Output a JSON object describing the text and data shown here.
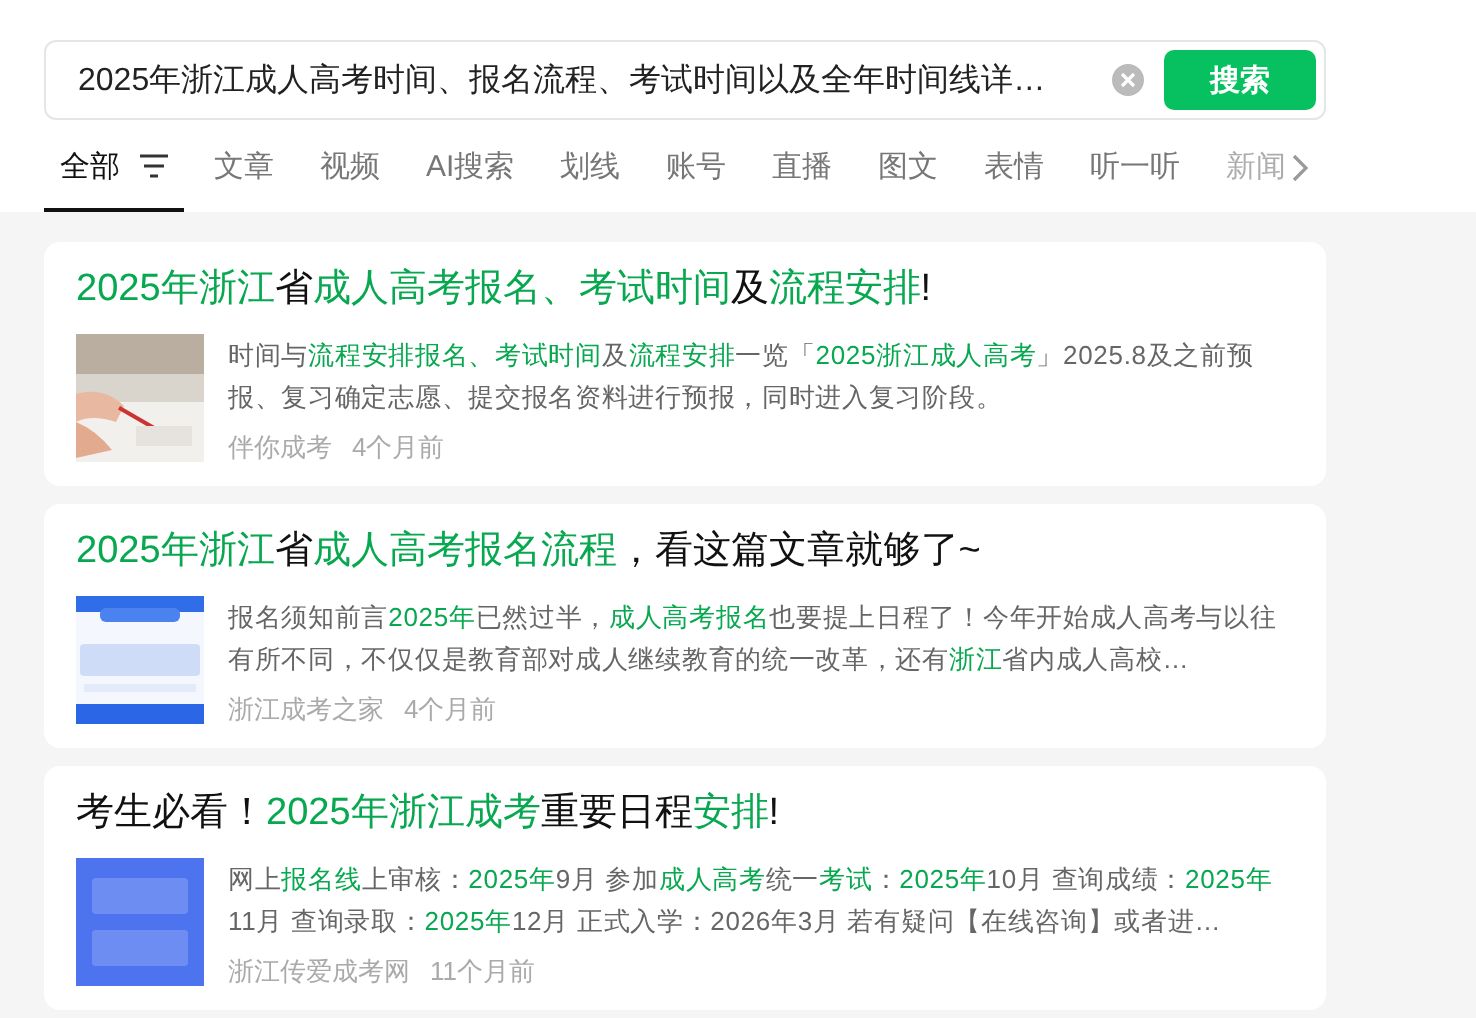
{
  "search": {
    "value": "2025年浙江成人高考时间、报名流程、考试时间以及全年时间线详…",
    "button": "搜索"
  },
  "tabs": [
    {
      "label": "全部",
      "selected": true,
      "filter": true
    },
    {
      "label": "文章",
      "selected": false
    },
    {
      "label": "视频",
      "selected": false
    },
    {
      "label": "AI搜索",
      "selected": false
    },
    {
      "label": "划线",
      "selected": false
    },
    {
      "label": "账号",
      "selected": false
    },
    {
      "label": "直播",
      "selected": false
    },
    {
      "label": "图文",
      "selected": false
    },
    {
      "label": "表情",
      "selected": false
    },
    {
      "label": "听一听",
      "selected": false
    },
    {
      "label": "新闻",
      "selected": false
    }
  ],
  "results": [
    {
      "title": [
        {
          "text": "2025年浙江",
          "highlight": true
        },
        {
          "text": "省",
          "highlight": false
        },
        {
          "text": "成人高考报名、考试时间",
          "highlight": true
        },
        {
          "text": "及",
          "highlight": false
        },
        {
          "text": "流程安排",
          "highlight": true
        },
        {
          "text": "!",
          "highlight": false
        }
      ],
      "thumbnail": {
        "kind": "picture"
      },
      "summary": [
        {
          "text": "时间与",
          "highlight": false
        },
        {
          "text": "流程安排报名、考试时间",
          "highlight": true
        },
        {
          "text": "及",
          "highlight": false
        },
        {
          "text": "流程安排",
          "highlight": true
        },
        {
          "text": "一览「",
          "highlight": false
        },
        {
          "text": "2025浙江成人高考",
          "highlight": true
        },
        {
          "text": "」2025.8及之前预报、复习确定志愿、提交报名资料进行预报，同时进入复习阶段。",
          "highlight": false
        }
      ],
      "source": "伴你成考",
      "time": "4个月前"
    },
    {
      "title": [
        {
          "text": "2025年浙江",
          "highlight": true
        },
        {
          "text": "省",
          "highlight": false
        },
        {
          "text": "成人高考报名流程",
          "highlight": true
        },
        {
          "text": "，看这篇文章就够了~",
          "highlight": false
        }
      ],
      "thumbnail": {
        "kind": "picture"
      },
      "summary": [
        {
          "text": "报名须知前言",
          "highlight": false
        },
        {
          "text": "2025年",
          "highlight": true
        },
        {
          "text": "已然过半，",
          "highlight": false
        },
        {
          "text": "成人高考报名",
          "highlight": true
        },
        {
          "text": "也要提上日程了！今年开始成人高考与以往有所不同，不仅仅是教育部对成人继续教育的统一改革，还有",
          "highlight": false
        },
        {
          "text": "浙江",
          "highlight": true
        },
        {
          "text": "省内成人高校…",
          "highlight": false
        }
      ],
      "source": "浙江成考之家",
      "time": "4个月前"
    },
    {
      "title": [
        {
          "text": "考生必看！",
          "highlight": false
        },
        {
          "text": "2025年浙江成考",
          "highlight": true
        },
        {
          "text": "重要日程",
          "highlight": false
        },
        {
          "text": "安排",
          "highlight": true
        },
        {
          "text": "!",
          "highlight": false
        }
      ],
      "thumbnail": {
        "kind": "picture"
      },
      "summary": [
        {
          "text": "网上",
          "highlight": false
        },
        {
          "text": "报名线",
          "highlight": true
        },
        {
          "text": "上审核：",
          "highlight": false
        },
        {
          "text": "2025年",
          "highlight": true
        },
        {
          "text": "9月 参加",
          "highlight": false
        },
        {
          "text": "成人高考",
          "highlight": true
        },
        {
          "text": "统一",
          "highlight": false
        },
        {
          "text": "考试",
          "highlight": true
        },
        {
          "text": "：",
          "highlight": false
        },
        {
          "text": "2025年",
          "highlight": true
        },
        {
          "text": "10月 查询成绩：",
          "highlight": false
        },
        {
          "text": "2025年",
          "highlight": true
        },
        {
          "text": "11月 查询录取：",
          "highlight": false
        },
        {
          "text": "2025年",
          "highlight": true
        },
        {
          "text": "12月 正式入学：2026年3月 若有疑问【在线咨询】或者进…",
          "highlight": false
        }
      ],
      "source": "浙江传爱成考网",
      "time": "11个月前"
    }
  ]
}
